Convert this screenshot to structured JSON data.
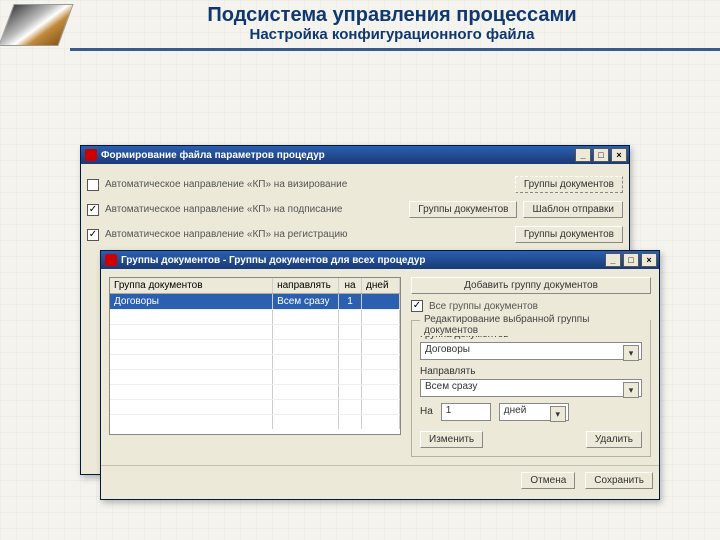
{
  "slide": {
    "title": "Подсистема управления процессами",
    "subtitle": "Настройка конфигурационного файла"
  },
  "window1": {
    "title": "Формирование файла параметров процедур",
    "rows": [
      {
        "checked": false,
        "label": "Автоматическое направление «КП» на визирование",
        "btn": "Группы документов",
        "btn_dashed": true
      },
      {
        "checked": true,
        "label": "Автоматическое направление «КП» на подписание",
        "btn": "Группы документов",
        "extra_btn": "Шаблон отправки"
      },
      {
        "checked": true,
        "label": "Автоматическое направление «КП» на регистрацию",
        "btn": "Группы документов"
      }
    ]
  },
  "window2": {
    "title": "Группы документов - Группы документов для всех процедур",
    "columns": [
      "Группа документов",
      "направлять",
      "на",
      "дней"
    ],
    "selected_row": {
      "doc": "Договоры",
      "route": "Всем сразу",
      "n": "1",
      "unit": ""
    },
    "add_btn": "Добавить группу документов",
    "all_groups_chk_label": "Все группы документов",
    "all_groups_checked": true,
    "group_title": "Редактирование выбранной группы документов",
    "field_group_label": "Группа документов",
    "field_group_value": "Договоры",
    "field_route_label": "Направлять",
    "field_route_value": "Всем сразу",
    "field_n_label": "На",
    "field_n_value": "1",
    "field_unit_value": "дней",
    "btn_change": "Изменить",
    "btn_delete": "Удалить",
    "btn_cancel": "Отмена",
    "btn_save": "Сохранить"
  }
}
